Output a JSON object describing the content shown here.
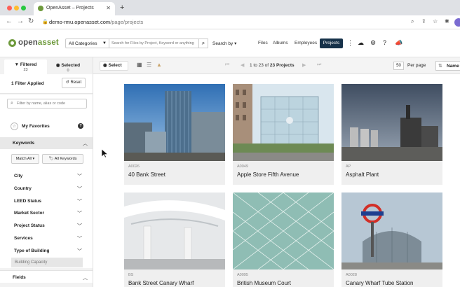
{
  "browser": {
    "tab_title": "OpenAsset – Projects",
    "url_host": "demo-rmu.openasset.com",
    "url_path": "/page/projects"
  },
  "header": {
    "logo_prefix": "open",
    "logo_suffix": "asset",
    "category_select": "All Categories",
    "search_placeholder": "Search for Files by Project, Keyword or anything",
    "search_by": "Search by",
    "nav": [
      "Files",
      "Albums",
      "Employees",
      "Projects"
    ],
    "active_nav": "Projects"
  },
  "filters": {
    "tab_filtered_label": "Filtered",
    "tab_filtered_count": "23",
    "tab_selected_label": "Selected",
    "tab_selected_count": "0",
    "applied_label": "1 Filter Applied",
    "reset_label": "Reset",
    "search_placeholder": "Filter by name, alias or code",
    "favorites_label": "My Favorites",
    "keywords_label": "Keywords",
    "match_label": "Match All",
    "all_keywords_label": "All Keywords",
    "facets": [
      "City",
      "Country",
      "LEED Status",
      "Market Sector",
      "Project Status",
      "Services",
      "Type of Building"
    ],
    "capacity_label": "Building Capacity",
    "fields_label": "Fields"
  },
  "toolbar": {
    "select_label": "Select",
    "pager_prefix": "1 to 23 of",
    "pager_total": "23 Projects",
    "per_page_value": "50",
    "per_page_label": "Per page",
    "sort_label": "Name"
  },
  "projects": [
    {
      "code": "A0026",
      "name": "40 Bank Street"
    },
    {
      "code": "A0049",
      "name": "Apple Store Fifth Avenue"
    },
    {
      "code": "AP",
      "name": "Asphalt Plant"
    },
    {
      "code": "BS",
      "name": "Bank Street Canary Wharf"
    },
    {
      "code": "A0095",
      "name": "British Museum Court"
    },
    {
      "code": "A0028",
      "name": "Canary Wharf Tube Station"
    }
  ],
  "colors": {
    "brand_green": "#6e9a3c",
    "active_nav_bg": "#17324a"
  }
}
